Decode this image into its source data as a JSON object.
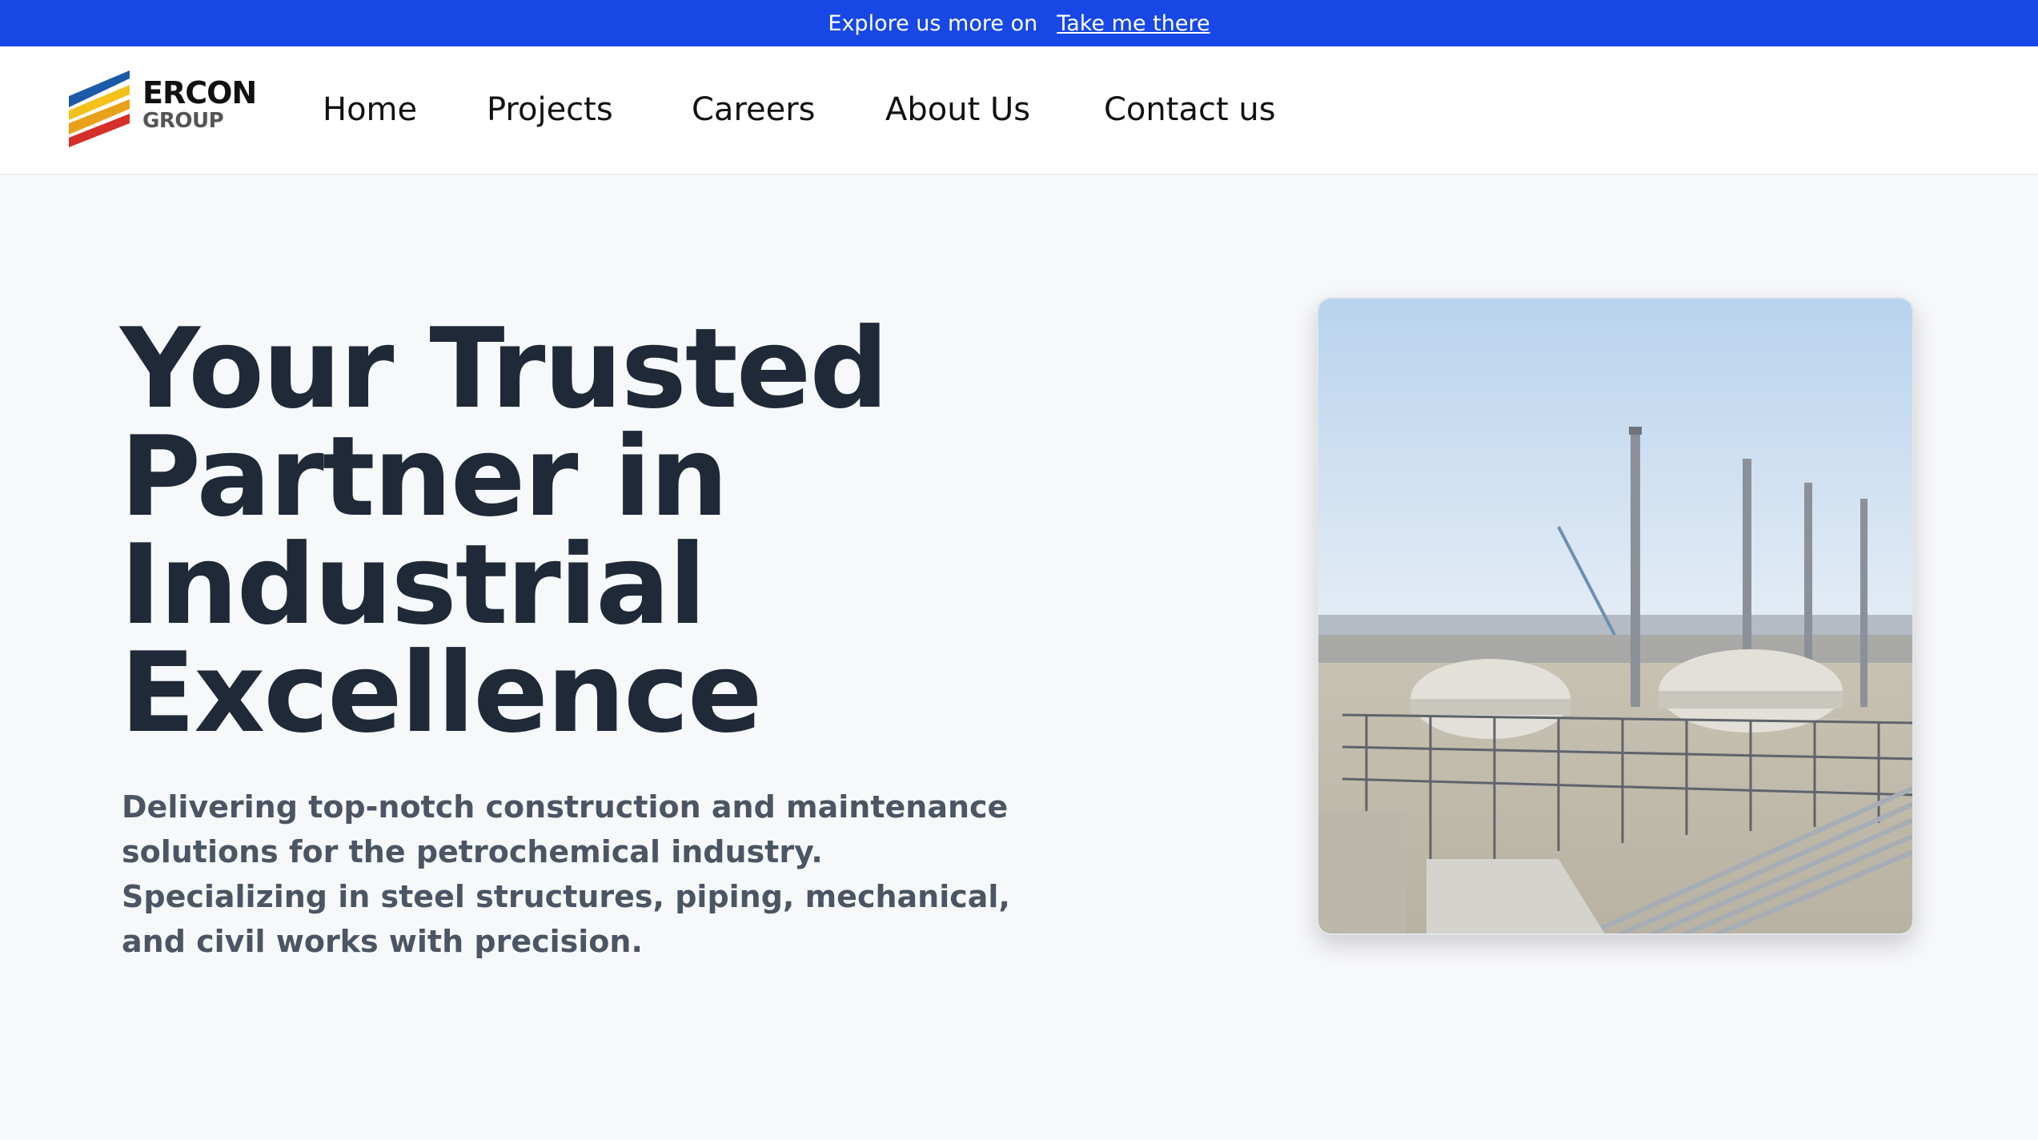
{
  "announcement": {
    "text": "Explore us more on",
    "link_label": "Take me there"
  },
  "brand": {
    "name_line1": "ERCON",
    "name_line2": "GROUP"
  },
  "nav": {
    "items": [
      {
        "label": "Home"
      },
      {
        "label": "Projects"
      },
      {
        "label": "Careers"
      },
      {
        "label": "About Us"
      },
      {
        "label": "Contact us"
      }
    ]
  },
  "hero": {
    "title_lines": [
      "Your Trusted",
      "Partner in",
      "Industrial",
      "Excellence"
    ],
    "description": "Delivering top-notch construction and maintenance solutions for the petrochemical industry. Specializing in steel structures, piping, mechanical, and civil works with precision."
  },
  "colors": {
    "accent": "#1748e6",
    "heading": "#1f2937",
    "body_text": "#4b5563",
    "background": "#f7f8fa"
  },
  "icons": {
    "logo": "ercon-stripes-logo"
  }
}
